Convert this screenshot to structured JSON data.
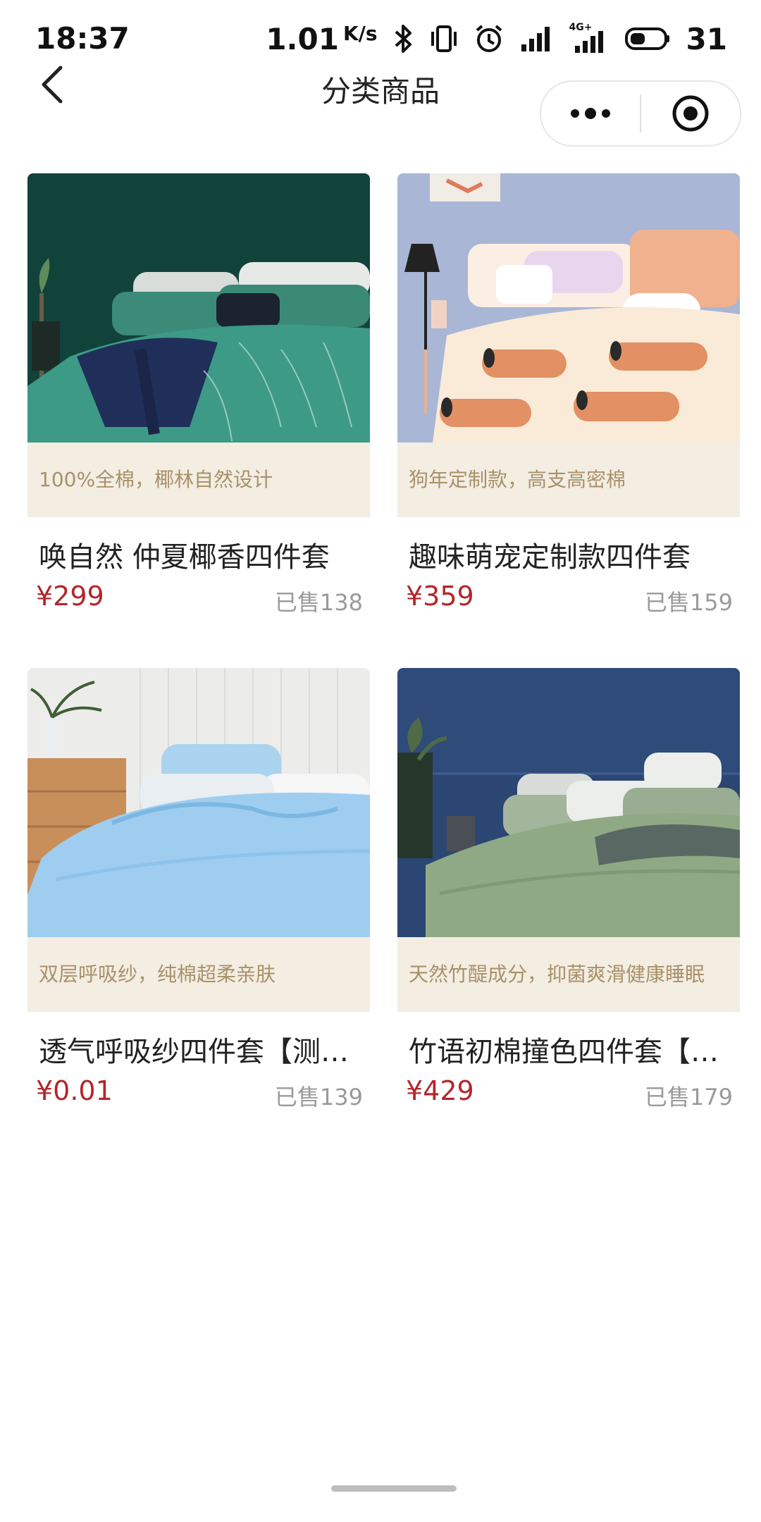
{
  "status_bar": {
    "time": "18:37",
    "speed_value": "1.01",
    "speed_unit": "K/s",
    "network_label": "4G+",
    "battery_level": "31"
  },
  "nav": {
    "title": "分类商品"
  },
  "products": [
    {
      "tagline": "100%全棉，椰林自然设计",
      "name": "唤自然 仲夏椰香四件套",
      "price": "¥299",
      "sold": "已售138"
    },
    {
      "tagline": "狗年定制款，高支高密棉",
      "name": "趣味萌宠定制款四件套",
      "price": "¥359",
      "sold": "已售159"
    },
    {
      "tagline": "双层呼吸纱，纯棉超柔亲肤",
      "name": "透气呼吸纱四件套【测…",
      "price": "¥0.01",
      "sold": "已售139"
    },
    {
      "tagline": "天然竹醍成分，抑菌爽滑健康睡眠",
      "name": "竹语初棉撞色四件套【…",
      "price": "¥429",
      "sold": "已售179"
    }
  ],
  "colors": {
    "price": "#b3262b",
    "tagline_bg": "#f3ede2",
    "tagline_text": "#a9916a",
    "sold_text": "#9a9a9a"
  }
}
